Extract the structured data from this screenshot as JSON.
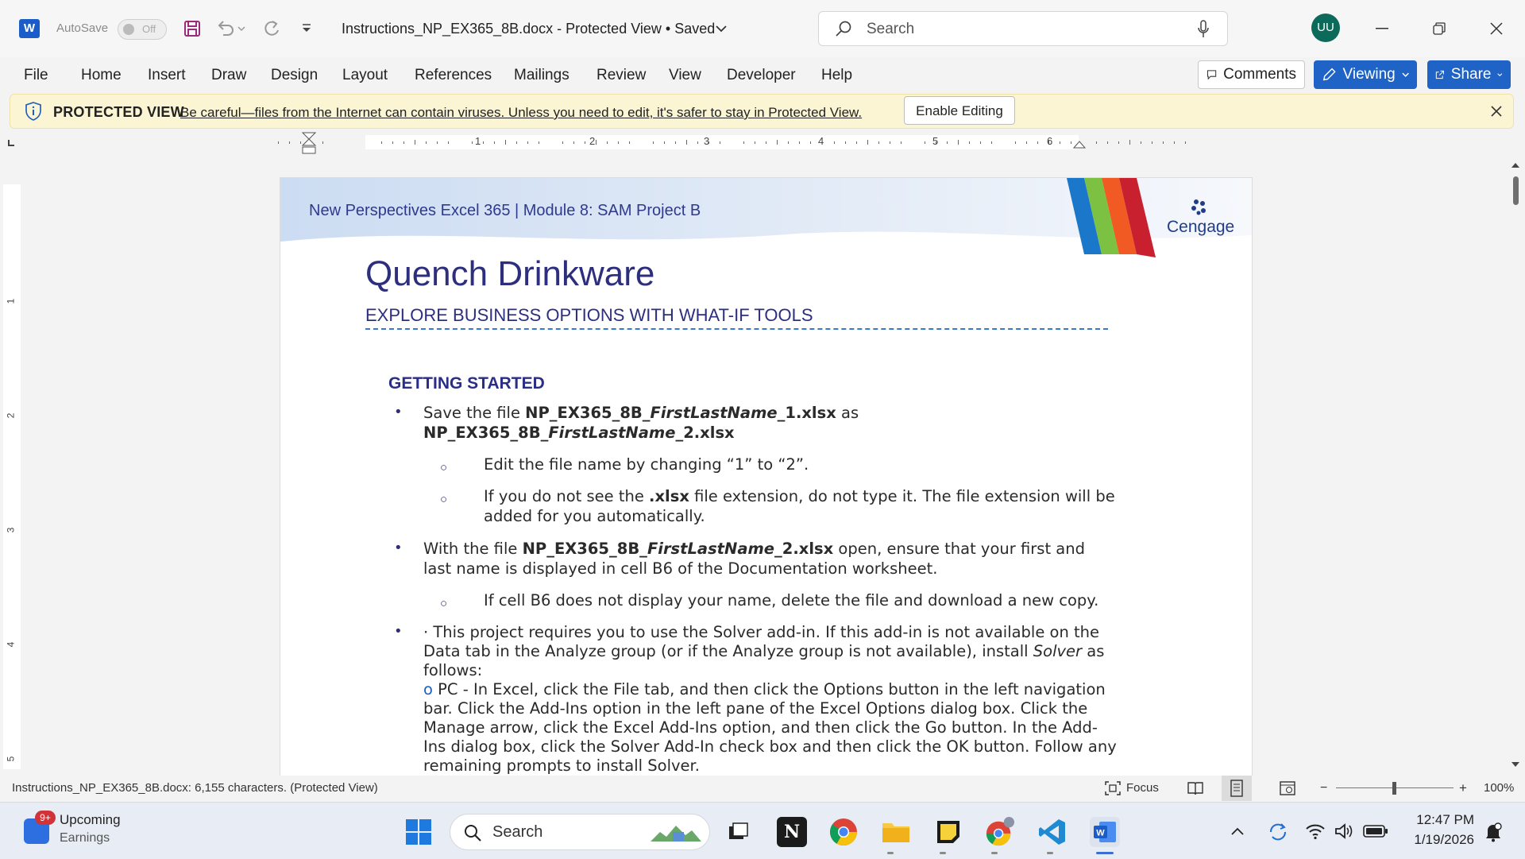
{
  "titlebar": {
    "app_logo_letter": "W",
    "autosave_label": "AutoSave",
    "autosave_state": "Off",
    "document_title": "Instructions_NP_EX365_8B.docx  -  Protected View • Saved",
    "search_placeholder": "Search",
    "user_initials": "UU"
  },
  "ribbon": {
    "tabs": [
      "File",
      "Home",
      "Insert",
      "Draw",
      "Design",
      "Layout",
      "References",
      "Mailings",
      "Review",
      "View",
      "Developer",
      "Help"
    ],
    "comments_label": "Comments",
    "viewing_label": "Viewing",
    "share_label": "Share"
  },
  "protected_view": {
    "title": "PROTECTED VIEW",
    "message": "Be careful—files from the Internet can contain viruses. Unless you need to edit, it's safer to stay in Protected View.",
    "enable_label": "Enable Editing"
  },
  "ruler": {
    "h_numbers": [
      "1",
      "2",
      "3",
      "4",
      "5",
      "6"
    ],
    "v_numbers": [
      "1",
      "2",
      "3",
      "4",
      "5"
    ]
  },
  "document": {
    "header_text": "New Perspectives Excel 365  |  Module 8: SAM Project B",
    "brand": "Cengage",
    "title": "Quench Drinkware",
    "subtitle": "EXPLORE BUSINESS OPTIONS WITH WHAT-IF TOOLS",
    "section_heading": "GETTING STARTED",
    "b1_a": "Save the file ",
    "b1_b": "NP_EX365_8B_",
    "b1_c": "FirstLastName",
    "b1_d": "_1.xlsx",
    "b1_e": " as",
    "b1_f": "NP_EX365_8B_",
    "b1_g": "FirstLastName",
    "b1_h": "_2.xlsx",
    "s1": "Edit the file name by changing “1” to “2”.",
    "s2_a": "If you do not see the ",
    "s2_b": ".xlsx",
    "s2_c": " file extension, do not type it. The file extension will be",
    "s2_d": "added for you automatically.",
    "b2_a": "With the file ",
    "b2_b": "NP_EX365_8B_",
    "b2_c": "FirstLastName",
    "b2_d": "_2.xlsx",
    "b2_e": " open, ensure that your first and",
    "b2_f": "last name is displayed in cell B6 of the Documentation worksheet.",
    "s3": "If cell B6 does not display your name, delete the file and download a new copy.",
    "b3_l1": "· This project requires you to use the Solver add-in. If this add-in is not available on the",
    "b3_l2a": "Data tab in the Analyze group (or if the Analyze group is not available), install ",
    "b3_l2b": "Solver",
    "b3_l2c": " as",
    "b3_l3": "follows:",
    "b3_l4a": "o",
    "b3_l4b": " PC - In Excel, click the File tab, and then click the Options button in the left navigation",
    "b3_l5": "bar. Click the Add-Ins option in the left pane of the Excel Options dialog box. Click the",
    "b3_l6": "Manage arrow, click the Excel Add-Ins option, and then click the Go button. In the Add-",
    "b3_l7": "Ins dialog box, click the Solver Add-In check box and then click the OK button. Follow any",
    "b3_l8": "remaining prompts to install Solver."
  },
  "status": {
    "text": "Instructions_NP_EX365_8B.docx: 6,155 characters.  (Protected View)",
    "focus_label": "Focus",
    "zoom": "100%"
  },
  "taskbar": {
    "widget_badge": "9+",
    "widget_title": "Upcoming",
    "widget_sub": "Earnings",
    "search_placeholder": "Search",
    "time": "12:47 PM",
    "date": "1/19/2026"
  },
  "colors": {
    "accent": "#2063c7",
    "doc_title": "#2d2f7e",
    "protected_bar": "#fcf5d3"
  }
}
